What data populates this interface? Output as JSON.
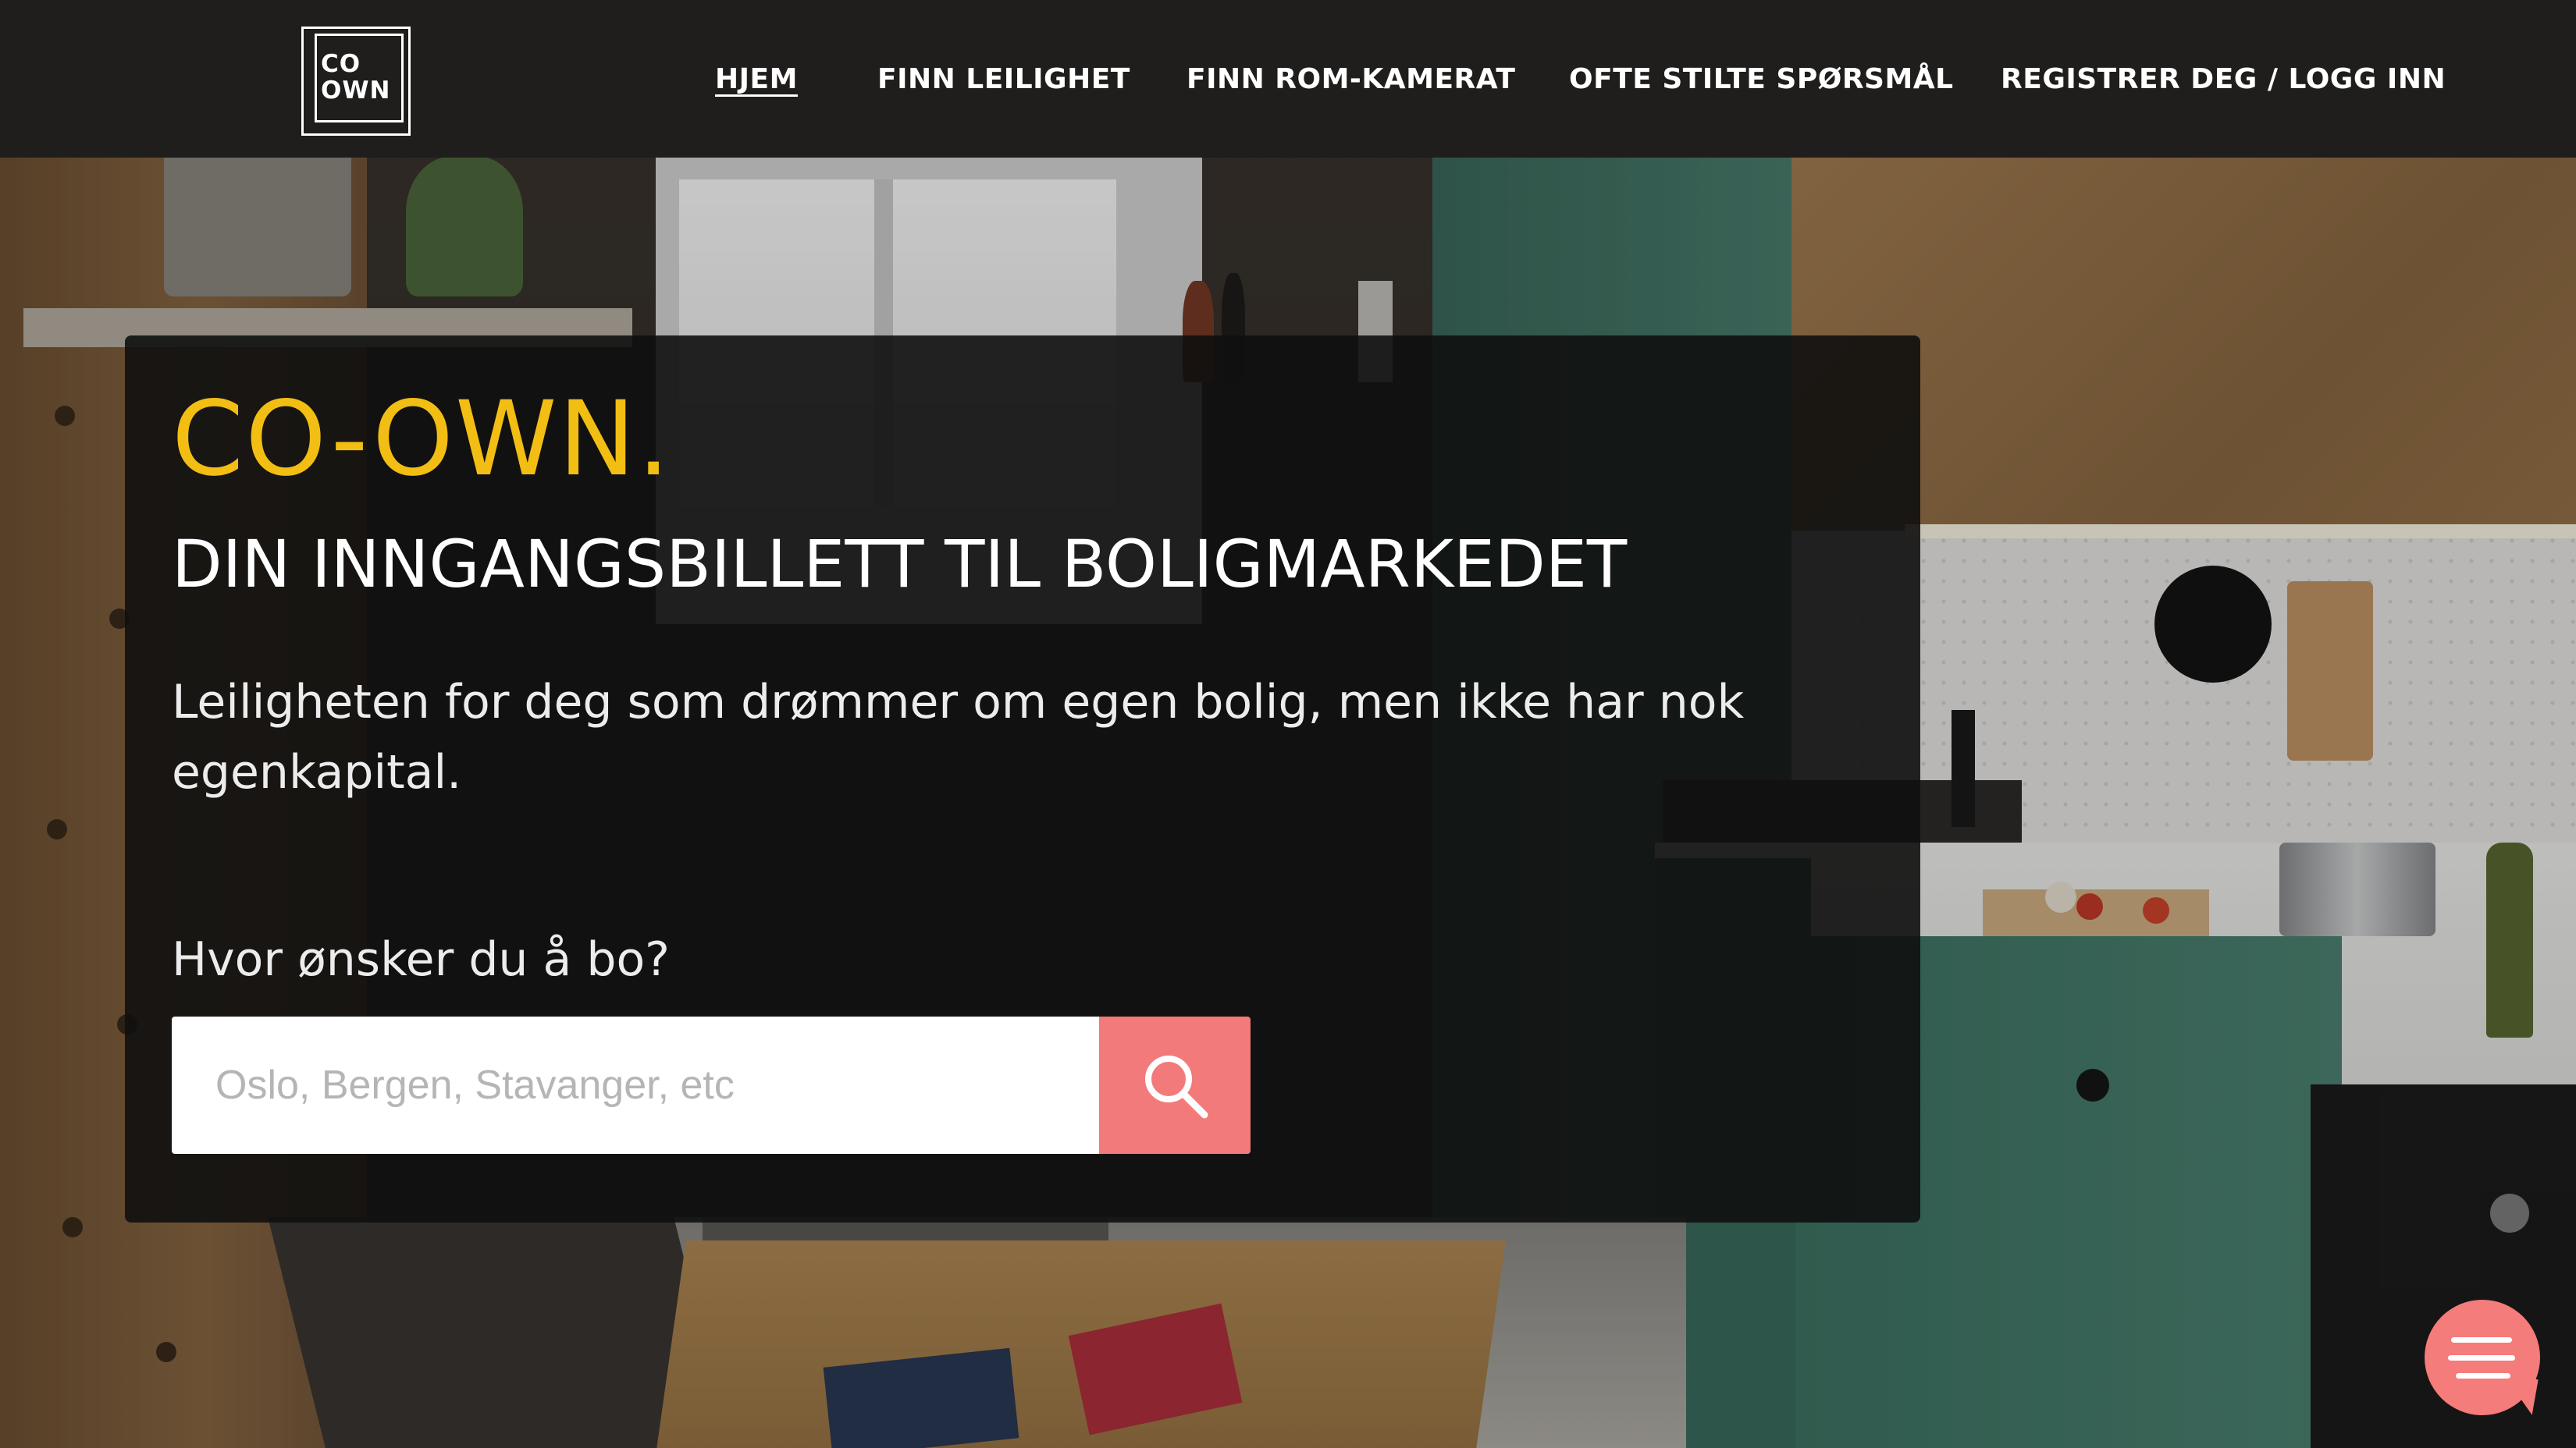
{
  "brand": {
    "logo_line1": "CO",
    "logo_line2": "OWN"
  },
  "nav": {
    "items": [
      {
        "label": "HJEM",
        "active": true
      },
      {
        "label": "FINN LEILIGHET",
        "active": false
      },
      {
        "label": "FINN ROM-KAMERAT",
        "active": false
      },
      {
        "label": "OFTE STILTE SPØRSMÅL",
        "active": false
      },
      {
        "label": "REGISTRER DEG / LOGG INN",
        "active": false
      }
    ]
  },
  "hero": {
    "title": "CO-OWN.",
    "subtitle": "DIN INNGANGSBILLETT TIL BOLIGMARKEDET",
    "description": "Leiligheten for deg som drømmer om egen bolig, men ikke har nok egenkapital.",
    "search_label": "Hvor ønsker du å bo?",
    "search_placeholder": "Oslo, Bergen, Stavanger, etc",
    "search_value": ""
  },
  "icons": {
    "search_button": "search-icon",
    "chat_widget": "chat-menu-icon"
  },
  "colors": {
    "accent_yellow": "#f2be13",
    "search_button": "#f27a7a",
    "chat_widget": "#f47c7a",
    "nav_background": "#1f1e1d"
  }
}
